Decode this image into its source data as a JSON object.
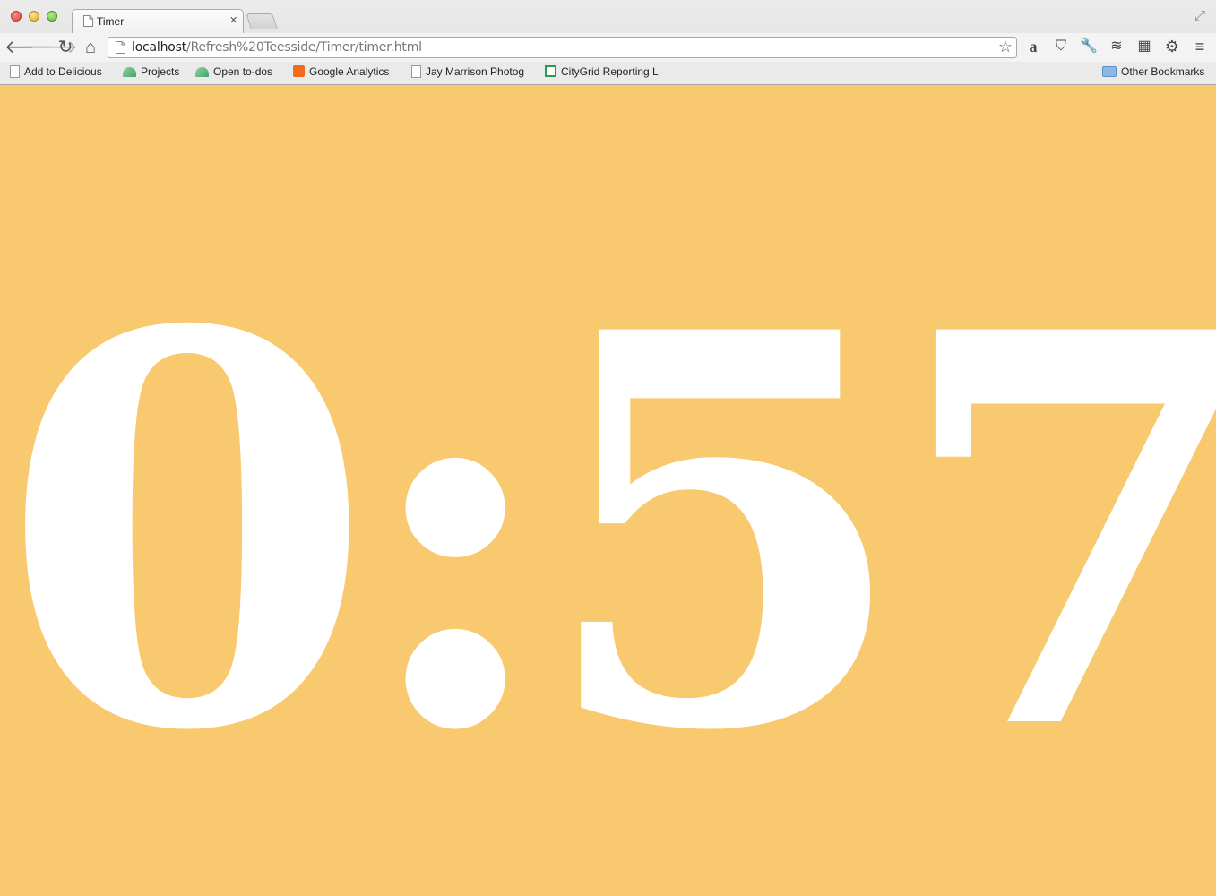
{
  "window": {
    "tab_title": "Timer",
    "url_host": "localhost",
    "url_path": "/Refresh%20Teesside/Timer/timer.html"
  },
  "toolbar": {
    "back_icon": "back-arrow-icon",
    "forward_icon": "forward-arrow-icon",
    "reload_icon": "reload-icon",
    "home_icon": "home-icon",
    "extensions": [
      "amazon-icon",
      "pocket-icon",
      "wrench-icon",
      "buffer-icon",
      "delicious-icon",
      "gear-icon",
      "menu-icon"
    ]
  },
  "bookmarks": {
    "items": [
      {
        "label": "Add to Delicious",
        "icon": "page-icon"
      },
      {
        "label": "Projects",
        "icon": "mountain-icon"
      },
      {
        "label": "Open to-dos",
        "icon": "mountain-icon"
      },
      {
        "label": "Google Analytics",
        "icon": "analytics-icon"
      },
      {
        "label": "Jay Marrison Photog",
        "icon": "page-icon"
      },
      {
        "label": "CityGrid Reporting L",
        "icon": "spreadsheet-icon"
      }
    ],
    "other_label": "Other Bookmarks"
  },
  "page": {
    "timer_text": "0:57",
    "background_color": "#f8c96f",
    "text_color": "#ffffff"
  }
}
